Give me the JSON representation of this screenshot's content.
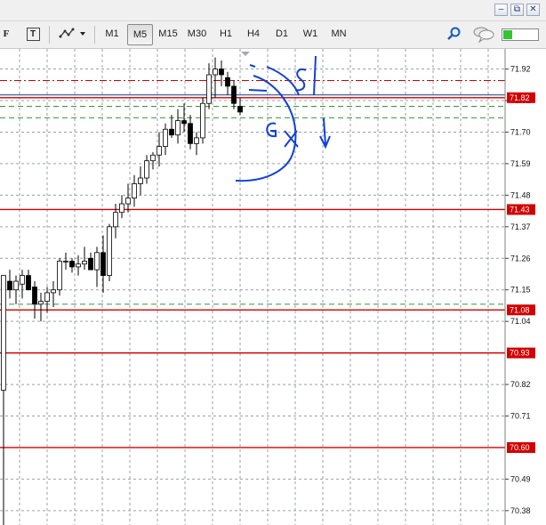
{
  "window": {
    "minimize_label": "–",
    "restore_label": "⧉",
    "close_label": "✕"
  },
  "toolbar": {
    "font_tool_label": "F",
    "text_tool_label": "T",
    "timeframes": [
      {
        "label": "M1",
        "active": false
      },
      {
        "label": "M5",
        "active": true
      },
      {
        "label": "M15",
        "active": false
      },
      {
        "label": "M30",
        "active": false
      },
      {
        "label": "H1",
        "active": false
      },
      {
        "label": "H4",
        "active": false
      },
      {
        "label": "D1",
        "active": false
      },
      {
        "label": "W1",
        "active": false
      },
      {
        "label": "MN",
        "active": false
      }
    ],
    "icons": [
      "text-icon",
      "objects-icon",
      "dropdown-arrow-icon",
      "zoom-search-icon",
      "chat-icon",
      "signal-status-icon"
    ],
    "signal_fill": 0.25
  },
  "chart_data": {
    "type": "candlestick",
    "price_axis_ticks": [
      "71.92",
      "71.81",
      "71.70",
      "71.59",
      "71.48",
      "71.37",
      "71.26",
      "71.15",
      "71.04",
      "70.93",
      "70.82",
      "70.71",
      "70.60",
      "70.49",
      "70.38"
    ],
    "price_tags": [
      {
        "label": "71.82",
        "color": "#d40000"
      },
      {
        "label": "71.43",
        "color": "#d40000"
      },
      {
        "label": "71.08",
        "color": "#d40000"
      },
      {
        "label": "70.93",
        "color": "#d40000"
      },
      {
        "label": "70.60",
        "color": "#d40000"
      }
    ],
    "horizontal_lines": [
      {
        "price": 71.82,
        "color": "#d40000",
        "style": "solid"
      },
      {
        "price": 71.83,
        "color": "#4a6aa8",
        "style": "solid"
      },
      {
        "price": 71.43,
        "color": "#d40000",
        "style": "solid"
      },
      {
        "price": 71.08,
        "color": "#d40000",
        "style": "solid"
      },
      {
        "price": 70.93,
        "color": "#d40000",
        "style": "solid"
      },
      {
        "price": 70.6,
        "color": "#d40000",
        "style": "solid"
      },
      {
        "price": 71.88,
        "color": "#d40000",
        "style": "dashdot"
      },
      {
        "price": 71.79,
        "color": "#2aa02a",
        "style": "dashed"
      },
      {
        "price": 71.75,
        "color": "#2aa02a",
        "style": "dashed"
      },
      {
        "price": 71.1,
        "color": "#2aa02a",
        "style": "dashed"
      }
    ],
    "ylim": [
      70.33,
      71.99
    ],
    "grid": true,
    "candles": [
      {
        "o": 70.8,
        "h": 71.2,
        "l": 70.33,
        "c": 71.2
      },
      {
        "o": 71.18,
        "h": 71.22,
        "l": 71.12,
        "c": 71.15
      },
      {
        "o": 71.15,
        "h": 71.2,
        "l": 71.1,
        "c": 71.18
      },
      {
        "o": 71.17,
        "h": 71.22,
        "l": 71.12,
        "c": 71.2
      },
      {
        "o": 71.2,
        "h": 71.22,
        "l": 71.15,
        "c": 71.15
      },
      {
        "o": 71.16,
        "h": 71.18,
        "l": 71.05,
        "c": 71.1
      },
      {
        "o": 71.1,
        "h": 71.14,
        "l": 71.04,
        "c": 71.11
      },
      {
        "o": 71.11,
        "h": 71.16,
        "l": 71.07,
        "c": 71.14
      },
      {
        "o": 71.14,
        "h": 71.18,
        "l": 71.09,
        "c": 71.15
      },
      {
        "o": 71.15,
        "h": 71.26,
        "l": 71.13,
        "c": 71.25
      },
      {
        "o": 71.25,
        "h": 71.28,
        "l": 71.22,
        "c": 71.25
      },
      {
        "o": 71.25,
        "h": 71.26,
        "l": 71.21,
        "c": 71.23
      },
      {
        "o": 71.23,
        "h": 71.27,
        "l": 71.2,
        "c": 71.24
      },
      {
        "o": 71.24,
        "h": 71.3,
        "l": 71.22,
        "c": 71.25
      },
      {
        "o": 71.26,
        "h": 71.28,
        "l": 71.22,
        "c": 71.22
      },
      {
        "o": 71.22,
        "h": 71.3,
        "l": 71.16,
        "c": 71.28
      },
      {
        "o": 71.28,
        "h": 71.34,
        "l": 71.14,
        "c": 71.2
      },
      {
        "o": 71.2,
        "h": 71.38,
        "l": 71.18,
        "c": 71.37
      },
      {
        "o": 71.37,
        "h": 71.45,
        "l": 71.33,
        "c": 71.42
      },
      {
        "o": 71.42,
        "h": 71.48,
        "l": 71.4,
        "c": 71.45
      },
      {
        "o": 71.45,
        "h": 71.52,
        "l": 71.42,
        "c": 71.47
      },
      {
        "o": 71.47,
        "h": 71.55,
        "l": 71.44,
        "c": 71.52
      },
      {
        "o": 71.52,
        "h": 71.58,
        "l": 71.48,
        "c": 71.54
      },
      {
        "o": 71.54,
        "h": 71.62,
        "l": 71.52,
        "c": 71.6
      },
      {
        "o": 71.6,
        "h": 71.63,
        "l": 71.57,
        "c": 71.62
      },
      {
        "o": 71.62,
        "h": 71.7,
        "l": 71.58,
        "c": 71.65
      },
      {
        "o": 71.65,
        "h": 71.73,
        "l": 71.62,
        "c": 71.71
      },
      {
        "o": 71.71,
        "h": 71.76,
        "l": 71.68,
        "c": 71.69
      },
      {
        "o": 71.69,
        "h": 71.78,
        "l": 71.66,
        "c": 71.74
      },
      {
        "o": 71.74,
        "h": 71.8,
        "l": 71.7,
        "c": 71.73
      },
      {
        "o": 71.73,
        "h": 71.76,
        "l": 71.64,
        "c": 71.66
      },
      {
        "o": 71.66,
        "h": 71.7,
        "l": 71.62,
        "c": 71.68
      },
      {
        "o": 71.68,
        "h": 71.82,
        "l": 71.66,
        "c": 71.8
      },
      {
        "o": 71.8,
        "h": 71.94,
        "l": 71.78,
        "c": 71.9
      },
      {
        "o": 71.9,
        "h": 71.96,
        "l": 71.82,
        "c": 71.92
      },
      {
        "o": 71.92,
        "h": 71.95,
        "l": 71.86,
        "c": 71.9
      },
      {
        "o": 71.89,
        "h": 71.91,
        "l": 71.83,
        "c": 71.86
      },
      {
        "o": 71.86,
        "h": 71.88,
        "l": 71.78,
        "c": 71.8
      },
      {
        "o": 71.79,
        "h": 71.82,
        "l": 71.76,
        "c": 71.77
      }
    ]
  }
}
